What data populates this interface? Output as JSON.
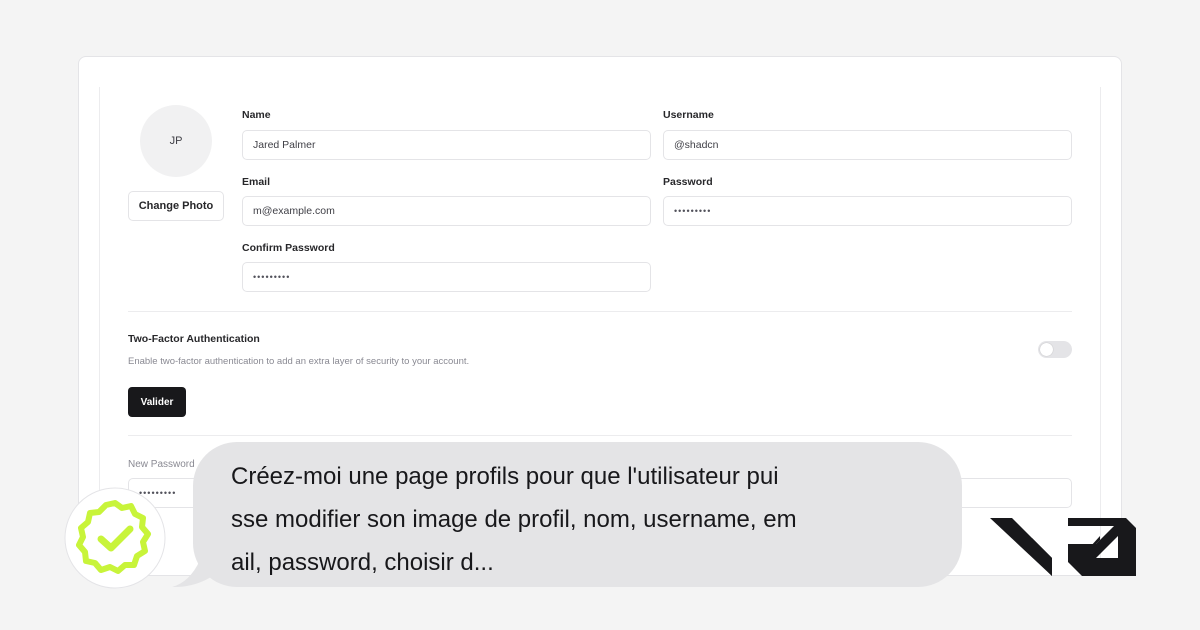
{
  "profile": {
    "avatar_initials": "JP",
    "change_photo_label": "Change Photo"
  },
  "fields": {
    "name": {
      "label": "Name",
      "value": "Jared Palmer"
    },
    "username": {
      "label": "Username",
      "value": "@shadcn"
    },
    "email": {
      "label": "Email",
      "value": "m@example.com"
    },
    "password": {
      "label": "Password",
      "value": "•••••••••"
    },
    "confirm_password": {
      "label": "Confirm Password",
      "value": "•••••••••"
    },
    "new_password": {
      "label": "New Password",
      "value": "•••••••••"
    }
  },
  "two_factor": {
    "title": "Two-Factor Authentication",
    "description": "Enable two-factor authentication to add an extra layer of security to your account.",
    "enabled": false
  },
  "validate_label": "Valider",
  "chat": {
    "prompt_text": "Créez-moi une page profils pour que l'utilisateur pui\nsse modifier son image de profil, nom, username, em\nail, password, choisir d..."
  },
  "colors": {
    "badge_accent": "#c8f43a",
    "dark_button": "#18181b",
    "bubble_bg": "#e4e4e6"
  },
  "icons": {
    "verified_badge": "verified-check-icon",
    "brand_logo": "v0-logo"
  }
}
